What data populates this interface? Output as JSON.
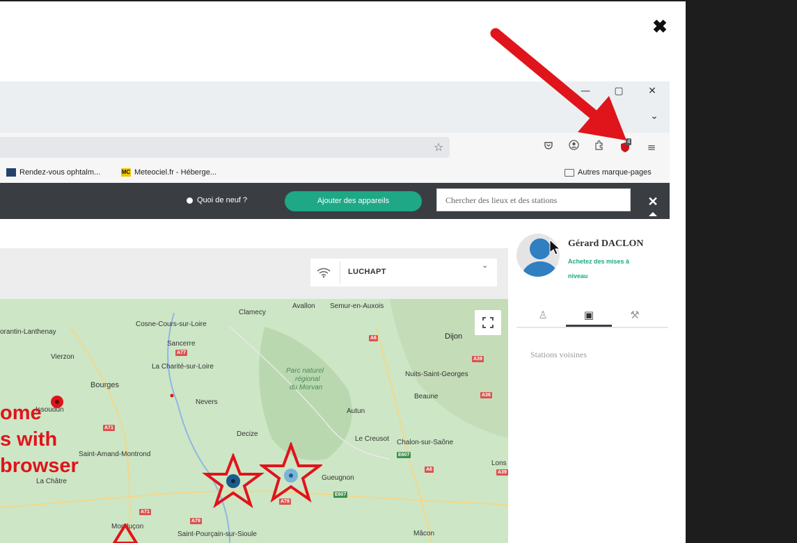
{
  "modal": {
    "close_icon": "close-icon",
    "close_label": "✖"
  },
  "window_controls": {
    "minimize": "—",
    "maximize": "▢",
    "close": "✕",
    "tabs_dropdown": "⌄"
  },
  "toolbar": {
    "bookmark_star": "☆",
    "icons": [
      "pocket-icon",
      "account-icon",
      "extensions-icon",
      "adblock-icon",
      "menu-icon"
    ],
    "adblock_badge": "4"
  },
  "bookmarks": [
    {
      "label": "Rendez-vous ophtalm...",
      "icon": "calendar-icon"
    },
    {
      "label": "Meteociel.fr - Héberge...",
      "icon": "mc-icon",
      "icon_text": "MC"
    },
    {
      "label": "Autres marque-pages",
      "icon": "folder-icon"
    }
  ],
  "app_header": {
    "whats_new": "Quoi de neuf ?",
    "add_devices": "Ajouter des appareils",
    "search_placeholder": "Chercher des lieux et des stations",
    "close_label": "✕"
  },
  "station_selector": {
    "name": "LUCHAPT",
    "chevron": "⌄"
  },
  "user": {
    "name": "Gérard DACLON",
    "upgrade_line1": "Achetez des mises à",
    "upgrade_line2": "niveau"
  },
  "side_tabs": [
    {
      "label": "user-tab",
      "glyph": "♙"
    },
    {
      "label": "stations-tab",
      "glyph": "▣"
    },
    {
      "label": "tools-tab",
      "glyph": "⚒"
    }
  ],
  "nearby_stations": "Stations voisines",
  "map": {
    "labels": [
      "Clamecy",
      "Avallon",
      "Semur-en-Auxois",
      "Cosne-Cours-sur-Loire",
      "orantin-Lanthenay",
      "Sancerre",
      "Dijon",
      "Vierzon",
      "La Charité-sur-Loire",
      "Parc naturel",
      "régional",
      "du Morvan",
      "Nuits-Saint-Georges",
      "Bourges",
      "Beaune",
      "Nevers",
      "Issoudun",
      "Autun",
      "Decize",
      "Le Creusot",
      "Chalon-sur-Saône",
      "Saint-Amand-Montrond",
      "Gueugnon",
      "Lons",
      "La Châtre",
      "Montluçon",
      "Saint-Pourçain-sur-Sioule",
      "Mâcon"
    ],
    "roads": [
      "A6",
      "A77",
      "A39",
      "A36",
      "A71",
      "E607",
      "A6",
      "A39",
      "A71",
      "A79",
      "A79",
      "E607"
    ],
    "annotation_lines": [
      "ome",
      "s with",
      "browser"
    ]
  },
  "colors": {
    "accent": "#1ea886",
    "header": "#3a3e43",
    "annotation": "#e0141b"
  }
}
